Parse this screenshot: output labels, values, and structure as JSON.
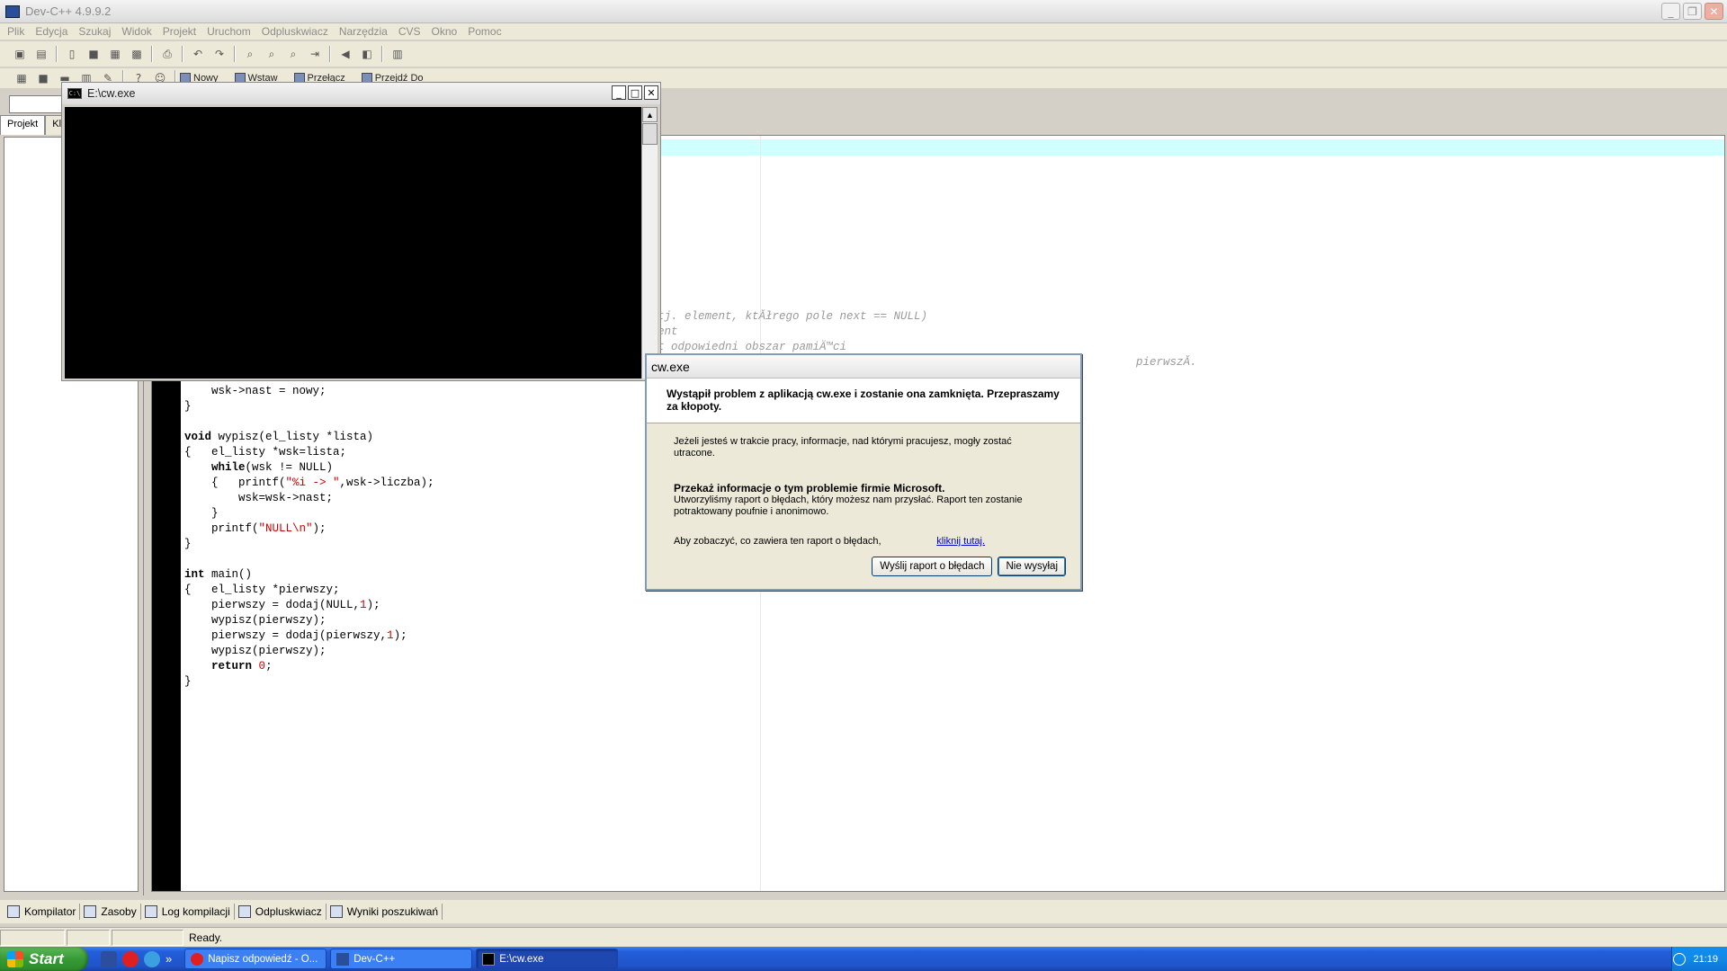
{
  "window": {
    "title": "Dev-C++ 4.9.9.2"
  },
  "menu": [
    "Plik",
    "Edycja",
    "Szukaj",
    "Widok",
    "Projekt",
    "Uruchom",
    "Odpluskwiacz",
    "Narzędzia",
    "CVS",
    "Okno",
    "Pomoc"
  ],
  "toolbar2": {
    "new_label": "Nowy",
    "insert_label": "Wstaw",
    "toggle_label": "Przełącz",
    "goto_label": "Przejdź Do"
  },
  "leftpanel": {
    "tab_project": "Projekt",
    "tab_classes": "Kl"
  },
  "editor": {
    "comments": [
      "tj. element, ktĂłrego pole next == NULL)",
      "ent",
      "t odpowiedni obszar pamiÄ™ci",
      "pierwszĂ."
    ],
    "lines": [
      {
        "segments": [
          {
            "t": "    wsk->nast = nowy;",
            "c": ""
          }
        ]
      },
      {
        "segments": [
          {
            "t": "}",
            "c": ""
          }
        ]
      },
      {
        "segments": [
          {
            "t": "",
            "c": ""
          }
        ]
      },
      {
        "segments": [
          {
            "t": "void",
            "c": "kw"
          },
          {
            "t": " wypisz(el_listy *lista)",
            "c": ""
          }
        ]
      },
      {
        "segments": [
          {
            "t": "{   el_listy *wsk=lista;",
            "c": ""
          }
        ]
      },
      {
        "segments": [
          {
            "t": "    ",
            "c": ""
          },
          {
            "t": "while",
            "c": "kw"
          },
          {
            "t": "(wsk != NULL)",
            "c": ""
          }
        ]
      },
      {
        "segments": [
          {
            "t": "    {   printf(",
            "c": ""
          },
          {
            "t": "\"%i -> \"",
            "c": "str"
          },
          {
            "t": ",wsk->liczba);",
            "c": ""
          }
        ]
      },
      {
        "segments": [
          {
            "t": "        wsk=wsk->nast;",
            "c": ""
          }
        ]
      },
      {
        "segments": [
          {
            "t": "    }",
            "c": ""
          }
        ]
      },
      {
        "segments": [
          {
            "t": "    printf(",
            "c": ""
          },
          {
            "t": "\"NULL\\n\"",
            "c": "str"
          },
          {
            "t": ");",
            "c": ""
          }
        ]
      },
      {
        "segments": [
          {
            "t": "}",
            "c": ""
          }
        ]
      },
      {
        "segments": [
          {
            "t": "",
            "c": ""
          }
        ]
      },
      {
        "segments": [
          {
            "t": "int",
            "c": "kw"
          },
          {
            "t": " main()",
            "c": ""
          }
        ]
      },
      {
        "segments": [
          {
            "t": "{   el_listy *pierwszy;",
            "c": ""
          }
        ]
      },
      {
        "segments": [
          {
            "t": "    pierwszy = dodaj(NULL,",
            "c": ""
          },
          {
            "t": "1",
            "c": "num"
          },
          {
            "t": ");",
            "c": ""
          }
        ]
      },
      {
        "segments": [
          {
            "t": "    wypisz(pierwszy);",
            "c": ""
          }
        ]
      },
      {
        "segments": [
          {
            "t": "    pierwszy = dodaj(pierwszy,",
            "c": ""
          },
          {
            "t": "1",
            "c": "num"
          },
          {
            "t": ");",
            "c": ""
          }
        ]
      },
      {
        "segments": [
          {
            "t": "    wypisz(pierwszy);",
            "c": ""
          }
        ]
      },
      {
        "segments": [
          {
            "t": "    ",
            "c": ""
          },
          {
            "t": "return",
            "c": "kw"
          },
          {
            "t": " ",
            "c": ""
          },
          {
            "t": "0",
            "c": "num"
          },
          {
            "t": ";",
            "c": ""
          }
        ]
      },
      {
        "segments": [
          {
            "t": "}",
            "c": ""
          }
        ]
      }
    ]
  },
  "console": {
    "title": "E:\\cw.exe"
  },
  "dialog": {
    "title": "cw.exe",
    "heading": "Wystąpił problem z aplikacją cw.exe i zostanie ona zamknięta. Przepraszamy za kłopoty.",
    "info": "Jeżeli jesteś w trakcie pracy, informacje, nad którymi pracujesz, mogły zostać utracone.",
    "report_heading": "Przekaż informacje o tym problemie firmie Microsoft.",
    "report_text": "Utworzyliśmy raport o błędach, który możesz nam przysłać. Raport ten zostanie potraktowany poufnie i anonimowo.",
    "see_text": "Aby zobaczyć, co zawiera ten raport o błędach,",
    "link_text": "kliknij tutaj.",
    "send_button": "Wyślij raport o błędach",
    "dont_send_button": "Nie wysyłaj"
  },
  "bottomtabs": [
    "Kompilator",
    "Zasoby",
    "Log kompilacji",
    "Odpluskwiacz",
    "Wyniki poszukiwań"
  ],
  "status": {
    "text": "Ready."
  },
  "taskbar": {
    "start": "Start",
    "chevron": "»",
    "tasks": [
      {
        "label": "Napisz odpowiedź - O...",
        "active": false
      },
      {
        "label": "Dev-C++",
        "active": false
      },
      {
        "label": "E:\\cw.exe",
        "active": true
      }
    ],
    "clock": "21:19"
  },
  "colors": {
    "accent": "#245edb",
    "start_green": "#379a36",
    "string_red": "#cc0000",
    "current_line": "#cfffff"
  }
}
